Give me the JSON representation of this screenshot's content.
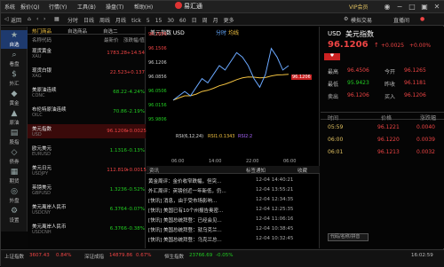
{
  "menu": {
    "items": [
      "系统",
      "报价(Q)",
      "行情(Y)",
      "工具(B)",
      "操盘(T)",
      "帮助(H)"
    ],
    "app_title": "易汇通",
    "vip": "VIP会员",
    "mini": "小窗"
  },
  "toolbar": {
    "back": "返回",
    "timeframes": [
      "分时",
      "日线",
      "周线",
      "月线",
      "tick",
      "5",
      "15",
      "30",
      "60",
      "日",
      "周",
      "月",
      "更多"
    ],
    "sim": "模拟交易",
    "direct": "直播间"
  },
  "sidebar": [
    "自选",
    "看盘",
    "外汇",
    "黄金",
    "原油",
    "股指",
    "债券",
    "期货",
    "外盘",
    "设置"
  ],
  "watchlist": {
    "tabs": [
      "热门商品",
      "自选商品",
      "自选二"
    ],
    "headers": [
      "名称代码",
      "最新价",
      "涨跌幅/值"
    ],
    "rows": [
      {
        "name": "现货黄金",
        "code": "XAU",
        "price": "1783.28",
        "change": "+14.54",
        "dir": "up"
      },
      {
        "name": "现货白银",
        "code": "XAG",
        "price": "22.523",
        "change": "+0.137",
        "dir": "up"
      },
      {
        "name": "美原油连续",
        "code": "CONC",
        "price": "68.22",
        "change": "-4.24%",
        "dir": "dn"
      },
      {
        "name": "布伦特原油连续",
        "code": "OILC",
        "price": "70.86",
        "change": "-2.19%",
        "dir": "dn"
      },
      {
        "name": "美元指数",
        "code": "USD",
        "price": "96.1206",
        "change": "+0.0025",
        "dir": "up",
        "selected": true
      },
      {
        "name": "欧元美元",
        "code": "EURUSD",
        "price": "1.1316",
        "change": "-0.13%",
        "dir": "dn"
      },
      {
        "name": "美元日元",
        "code": "USDJPY",
        "price": "112.810",
        "change": "+0.0015",
        "dir": "up"
      },
      {
        "name": "英镑美元",
        "code": "GBPUSD",
        "price": "1.3236",
        "change": "-0.52%",
        "dir": "dn"
      },
      {
        "name": "美元离岸人民币",
        "code": "USDCNY",
        "price": "6.3764",
        "change": "-0.07%",
        "dir": "dn"
      },
      {
        "name": "美元离岸人民币",
        "code": "USDCNH",
        "price": "6.3766",
        "change": "-0.38%",
        "dir": "dn"
      }
    ]
  },
  "chart": {
    "title": "美元指数 USD",
    "modes": [
      "分时",
      "均线"
    ],
    "y_ticks": [
      "96.1856",
      "96.1506",
      "96.1206",
      "96.0856",
      "96.0506",
      "96.0156",
      "95.9806"
    ],
    "current_price_tag": "96.1206",
    "rsi_label": "RSI(6,12,24)",
    "rsi_vals": [
      "RSI1:0.1343",
      "RSI2:2"
    ],
    "time_ticks": [
      "06:00",
      "14:00",
      "22:00",
      "06:00"
    ]
  },
  "chart_data": {
    "type": "line",
    "series": [
      {
        "values": [
          96.04,
          96.05,
          96.06,
          96.05,
          96.07,
          96.09,
          96.08,
          96.1,
          96.12,
          96.11,
          96.13,
          96.15,
          96.14,
          96.12,
          96.09,
          96.07,
          96.1,
          96.16,
          96.14,
          96.11,
          96.12
        ]
      }
    ],
    "ylim": [
      95.98,
      96.19
    ]
  },
  "news": {
    "tabs": [
      "资讯",
      "标签通知",
      "收藏"
    ],
    "items": [
      {
        "title": "黄金周评：金价收窄跌幅，但突...",
        "date": "12-04 14:40:21"
      },
      {
        "title": "外汇周评：英镑创近一年新低，仍...",
        "date": "12-04 13:55:21"
      },
      {
        "title": "[快讯] 消息，由于受市场影响...",
        "date": "12-04 12:34:35"
      },
      {
        "title": "[快讯] 美国已有10个州报告奥密...",
        "date": "12-04 12:25:35"
      },
      {
        "title": "[快讯] 美国总统拜登：已经会见...",
        "date": "12-04 11:06:16"
      },
      {
        "title": "[快讯] 美国总统拜登：就乌克兰...",
        "date": "12-04 10:38:45"
      },
      {
        "title": "[快讯] 美国总统拜登：乌克兰总...",
        "date": "12-04 10:32:45"
      }
    ]
  },
  "quote": {
    "code": "USD",
    "name": "美元指数",
    "price": "96.1206",
    "change": "+0.0025",
    "pct": "+0.00%",
    "fields": [
      {
        "k": "最高",
        "v": "96.4506",
        "k2": "今开",
        "v2": "96.1265"
      },
      {
        "k": "最低",
        "v": "95.9423",
        "k2": "昨收",
        "v2": "96.1181"
      },
      {
        "k": "卖出",
        "v": "96.1206",
        "k2": "买入",
        "v2": "96.1206"
      }
    ],
    "tick_header": [
      "时间",
      "价格",
      "涨跌幅"
    ],
    "ticks": [
      {
        "t": "05:59",
        "p": "96.1221",
        "c": "0.0040"
      },
      {
        "t": "06:00",
        "p": "96.1220",
        "c": "0.0039"
      },
      {
        "t": "06:01",
        "p": "96.1213",
        "c": "0.0032"
      }
    ]
  },
  "search_placeholder": "代码/名称/拼音",
  "statusbar": {
    "items": [
      {
        "label": "上证指数",
        "val": "3607.43",
        "chg": "0.84%",
        "dir": "up"
      },
      {
        "label": "深证成指",
        "val": "14879.86",
        "chg": "0.67%",
        "dir": "up"
      },
      {
        "label": "恒生指数",
        "val": "23766.69",
        "chg": "-0.05%",
        "dir": "dn"
      }
    ],
    "time": "16:02:59"
  }
}
